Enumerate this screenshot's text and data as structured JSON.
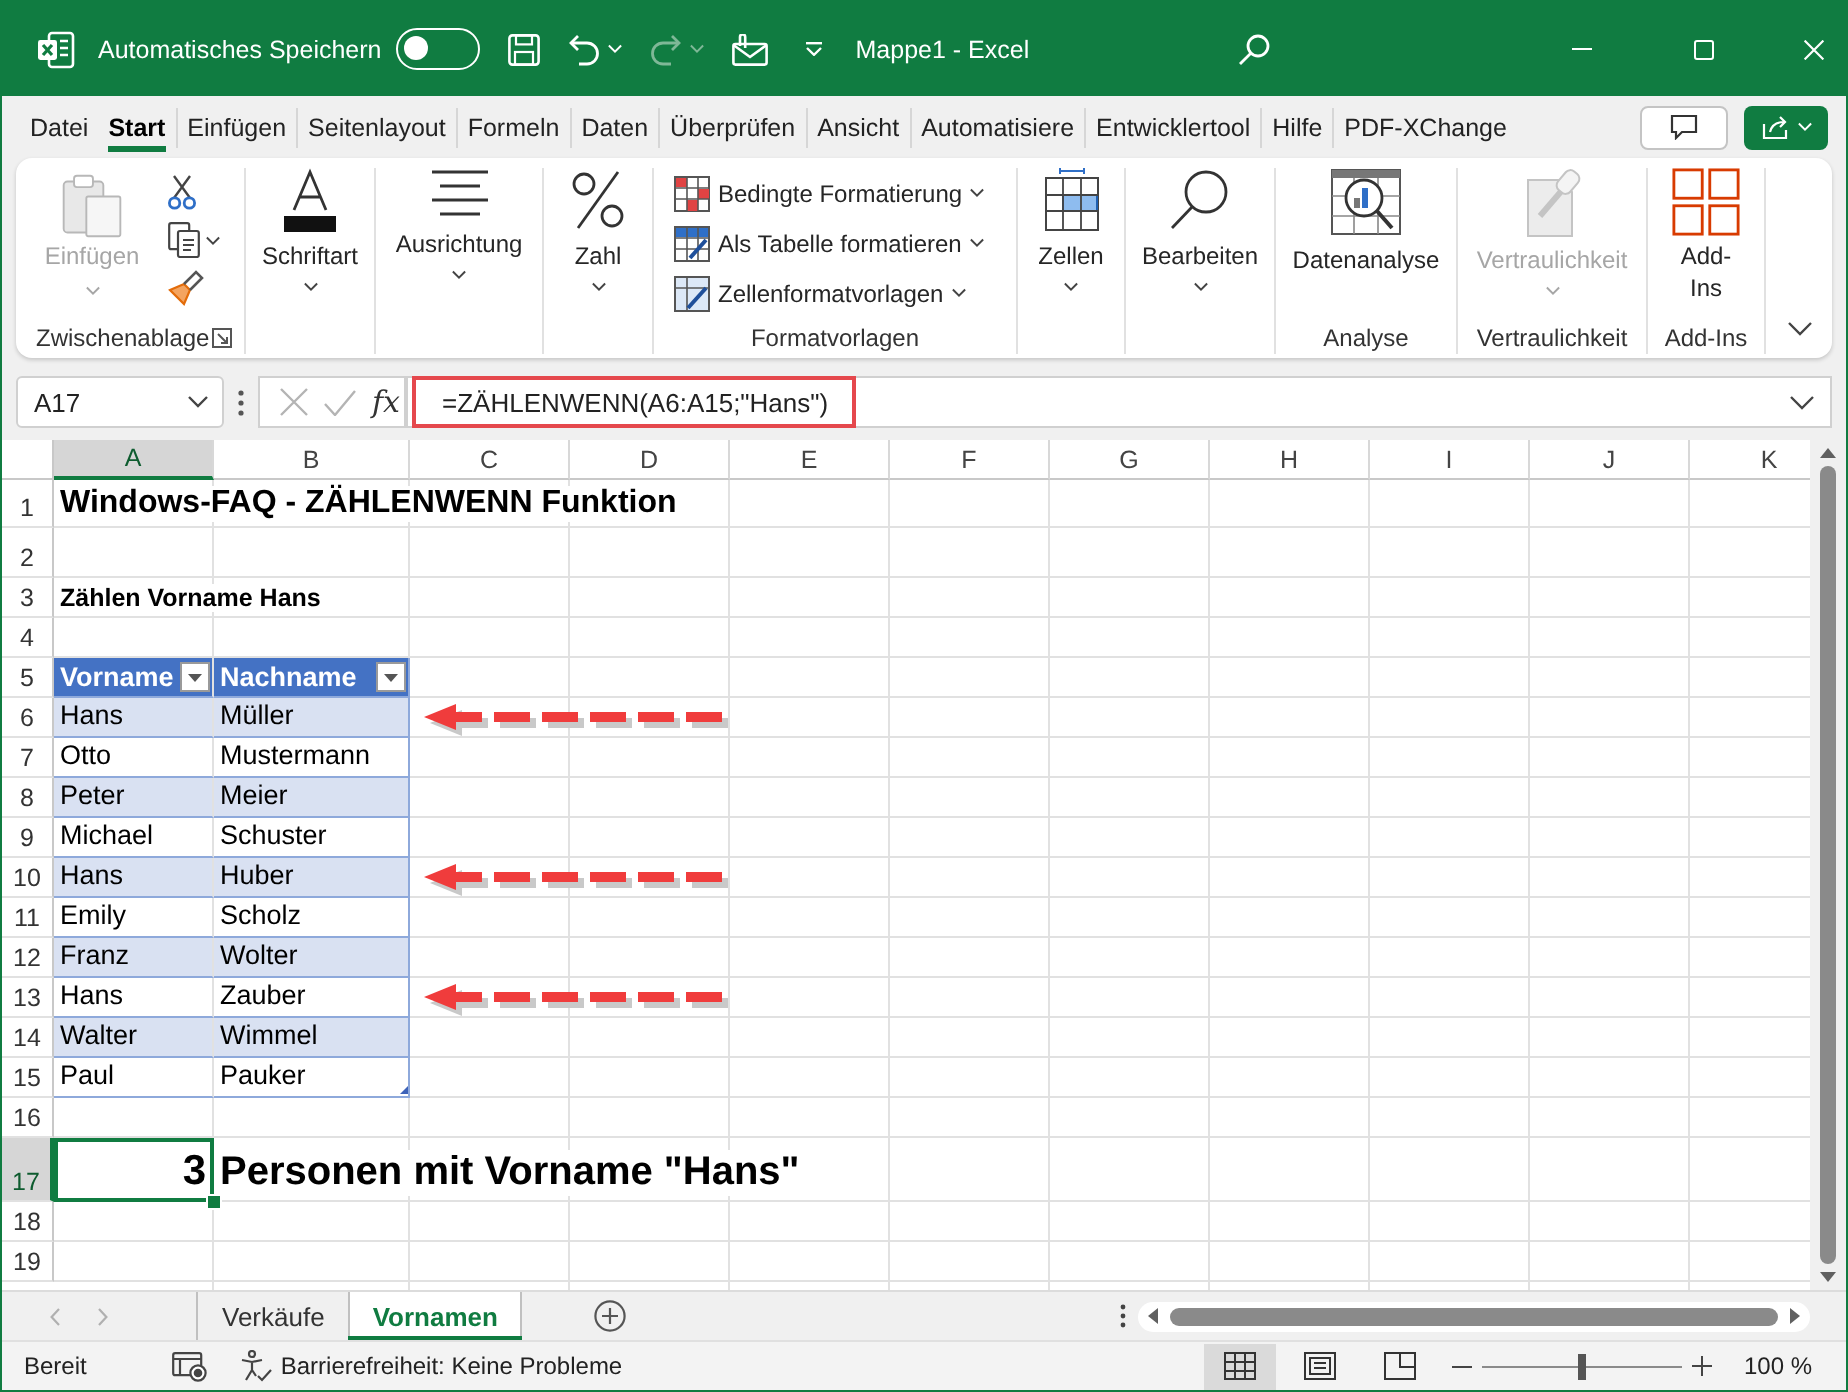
{
  "title_bar": {
    "autosave_label": "Automatisches Speichern",
    "autosave_on": false,
    "quick_access": [
      {
        "disabled": false,
        "dropdown": false
      },
      {
        "disabled": false,
        "dropdown": true
      },
      {
        "disabled": true,
        "dropdown": true
      },
      {
        "disabled": false,
        "dropdown": false
      }
    ],
    "title": "Mappe1 - Excel"
  },
  "menu_tabs": [
    {
      "label": "Datei",
      "selected": false
    },
    {
      "label": "Start",
      "selected": true
    },
    {
      "label": "Einfügen",
      "selected": false
    },
    {
      "label": "Seitenlayout",
      "selected": false
    },
    {
      "label": "Formeln",
      "selected": false
    },
    {
      "label": "Daten",
      "selected": false
    },
    {
      "label": "Überprüfen",
      "selected": false
    },
    {
      "label": "Ansicht",
      "selected": false
    },
    {
      "label": "Automatisiere",
      "selected": false
    },
    {
      "label": "Entwicklertool",
      "selected": false
    },
    {
      "label": "Hilfe",
      "selected": false
    },
    {
      "label": "PDF-XChange",
      "selected": false
    }
  ],
  "ribbon": {
    "groups": [
      {
        "kind": "clipboard",
        "label": "Zwischenablage",
        "launcher": true,
        "paste": {
          "label": "Einfügen",
          "disabled": true
        }
      },
      {
        "kind": "collapsed",
        "button": "Schriftart"
      },
      {
        "kind": "collapsed",
        "button": "Ausrichtung"
      },
      {
        "kind": "collapsed",
        "button": "Zahl"
      },
      {
        "kind": "list",
        "label": "Formatvorlagen",
        "items": [
          "Bedingte Formatierung",
          "Als Tabelle formatieren",
          "Zellenformatvorlagen"
        ]
      },
      {
        "kind": "collapsed",
        "button": "Zellen"
      },
      {
        "kind": "collapsed",
        "button": "Bearbeiten"
      },
      {
        "kind": "large",
        "label": "Analyse",
        "button": {
          "label": "Datenanalyse",
          "disabled": false,
          "dropdown": false
        }
      },
      {
        "kind": "large",
        "label": "Vertraulichkeit",
        "button": {
          "label": "Vertraulichkeit",
          "disabled": true,
          "dropdown": true
        }
      },
      {
        "kind": "large",
        "label": "Add-Ins",
        "button": {
          "label": "Add-Ins",
          "disabled": false,
          "dropdown": false
        }
      }
    ]
  },
  "formula_bar": {
    "name_box": "A17",
    "entry_buttons_disabled": true,
    "function_button": "fx",
    "formula": "=ZÄHLENWENN(A6:A15;\"Hans\")",
    "highlighted": true
  },
  "sheet": {
    "columns": [
      {
        "label": "A",
        "selected": true
      },
      {
        "label": "B",
        "selected": false
      },
      {
        "label": "C",
        "selected": false
      },
      {
        "label": "D",
        "selected": false
      },
      {
        "label": "E",
        "selected": false
      },
      {
        "label": "F",
        "selected": false
      },
      {
        "label": "G",
        "selected": false
      },
      {
        "label": "H",
        "selected": false
      },
      {
        "label": "I",
        "selected": false
      },
      {
        "label": "J",
        "selected": false
      },
      {
        "label": "K",
        "selected": false
      }
    ],
    "rows": [
      {
        "label": "1",
        "selected": false,
        "kind": "title",
        "text": "Windows-FAQ - ZÄHLENWENN Funktion"
      },
      {
        "label": "2",
        "selected": false,
        "kind": "blank"
      },
      {
        "label": "3",
        "selected": false,
        "kind": "heading",
        "text": "Zählen Vorname Hans"
      },
      {
        "label": "4",
        "selected": false,
        "kind": "blank"
      },
      {
        "label": "5",
        "selected": false,
        "kind": "table_header",
        "cells": [
          "Vorname",
          "Nachname"
        ]
      },
      {
        "label": "6",
        "selected": false,
        "kind": "table_row",
        "cells": [
          "Hans",
          "Müller"
        ],
        "marked": true
      },
      {
        "label": "7",
        "selected": false,
        "kind": "table_row",
        "cells": [
          "Otto",
          "Mustermann"
        ],
        "marked": false
      },
      {
        "label": "8",
        "selected": false,
        "kind": "table_row",
        "cells": [
          "Peter",
          "Meier"
        ],
        "marked": false
      },
      {
        "label": "9",
        "selected": false,
        "kind": "table_row",
        "cells": [
          "Michael",
          "Schuster"
        ],
        "marked": false
      },
      {
        "label": "10",
        "selected": false,
        "kind": "table_row",
        "cells": [
          "Hans",
          "Huber"
        ],
        "marked": true
      },
      {
        "label": "11",
        "selected": false,
        "kind": "table_row",
        "cells": [
          "Emily",
          "Scholz"
        ],
        "marked": false
      },
      {
        "label": "12",
        "selected": false,
        "kind": "table_row",
        "cells": [
          "Franz",
          "Wolter"
        ],
        "marked": false
      },
      {
        "label": "13",
        "selected": false,
        "kind": "table_row",
        "cells": [
          "Hans",
          "Zauber"
        ],
        "marked": true
      },
      {
        "label": "14",
        "selected": false,
        "kind": "table_row",
        "cells": [
          "Walter",
          "Wimmel"
        ],
        "marked": false
      },
      {
        "label": "15",
        "selected": false,
        "kind": "table_row",
        "cells": [
          "Paul",
          "Pauker"
        ],
        "marked": false
      },
      {
        "label": "16",
        "selected": false,
        "kind": "blank"
      },
      {
        "label": "17",
        "selected": true,
        "kind": "result",
        "value": "3",
        "text": "Personen mit Vorname \"Hans\""
      },
      {
        "label": "18",
        "selected": false,
        "kind": "blank"
      },
      {
        "label": "19",
        "selected": false,
        "kind": "blank"
      }
    ]
  },
  "sheet_tabs": [
    {
      "label": "Verkäufe",
      "selected": false
    },
    {
      "label": "Vornamen",
      "selected": true
    }
  ],
  "status_bar": {
    "status": "Bereit",
    "accessibility": "Barrierefreiheit: Keine Probleme",
    "views": [
      {
        "selected": true
      },
      {
        "selected": false
      },
      {
        "selected": false
      }
    ],
    "zoom": {
      "level": 0.5,
      "reading": "100 %"
    }
  }
}
